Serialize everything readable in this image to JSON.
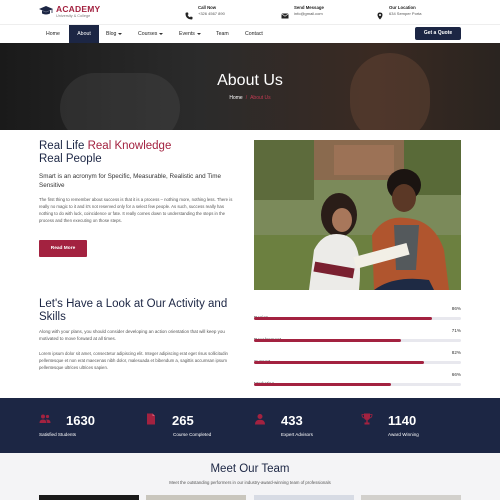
{
  "brand": {
    "name": "ACADEMY",
    "tagline": "University & College"
  },
  "contacts": [
    {
      "icon": "phone-icon",
      "title": "Call Now",
      "value": "+326 4567 890"
    },
    {
      "icon": "envelope-icon",
      "title": "Send Message",
      "value": "info@gmail.com"
    },
    {
      "icon": "map-pin-icon",
      "title": "Our Location",
      "value": "634 Semper Porta"
    }
  ],
  "nav": {
    "items": [
      "Home",
      "About",
      "Blog",
      "Courses",
      "Events",
      "Team",
      "Contact"
    ],
    "active": "About",
    "quote_label": "Get a Quote"
  },
  "hero": {
    "title": "About Us",
    "crumb_home": "Home",
    "crumb_sep": "/",
    "crumb_current": "About Us"
  },
  "about": {
    "title_1": "Real Life ",
    "title_accent": "Real Knowledge",
    "title_2": "Real People",
    "subtitle": "Smart is an acronym for Specific, Measurable, Realistic and Time Sensitive",
    "body": "The first thing to remember about success is that it is a process – nothing more, nothing less. There is really no magic to it and it's not reserved only for a select few people. As such, success really has nothing to do with luck, coincidence or fate. It really comes down to understanding the steps in the process and then executing on those steps.",
    "button": "Read More"
  },
  "activity": {
    "title": "Let's Have a Look at Our Activity and Skills",
    "p1": "Along with your plans, you should consider developing an action orientation that will keep you motivated to move forward at all times.",
    "p2": "Lorem ipsum dolor sit amet, consectetur adipiscing elit. Integer adipiscing erat eget risus sollicitudin pellentesque et non erat maecenas nibh dolor, malesuada et bibendum a, sagittis accumsan ipsum pellentesque ultrices ultrices sapien."
  },
  "skills": [
    {
      "label": "Design",
      "percent_text": "86%",
      "value": 86
    },
    {
      "label": "Development",
      "percent_text": "71%",
      "value": 71
    },
    {
      "label": "Support",
      "percent_text": "82%",
      "value": 82
    },
    {
      "label": "Marketing",
      "percent_text": "66%",
      "value": 66
    }
  ],
  "stats": [
    {
      "icon": "users-icon",
      "number": "1630",
      "caption": "Satisfied Students"
    },
    {
      "icon": "document-icon",
      "number": "265",
      "caption": "Course Completed"
    },
    {
      "icon": "advisor-icon",
      "number": "433",
      "caption": "Expert Advisors"
    },
    {
      "icon": "trophy-icon",
      "number": "1140",
      "caption": "Award Winning"
    }
  ],
  "team": {
    "title": "Meet Our Team",
    "subtitle": "Meet the outstanding performers in our industry-award-winning team of professionals"
  },
  "colors": {
    "navy": "#1c2644",
    "accent": "#a32240"
  }
}
